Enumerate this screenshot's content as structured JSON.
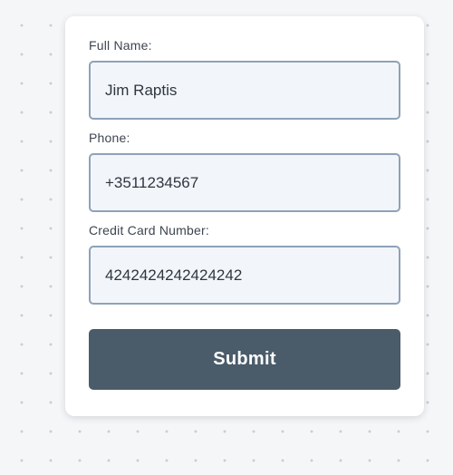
{
  "form": {
    "fields": [
      {
        "label": "Full Name:",
        "value": "Jim Raptis"
      },
      {
        "label": "Phone:",
        "value": "+3511234567"
      },
      {
        "label": "Credit Card Number:",
        "value": "4242424242424242"
      }
    ],
    "submit_label": "Submit"
  },
  "colors": {
    "background": "#f5f6f8",
    "dot": "#c9ced6",
    "card": "#ffffff",
    "input_border": "#8fa2b7",
    "input_background": "#f2f6fa",
    "button": "#4a5b69",
    "button_text": "#ffffff",
    "label_text": "#3d4550"
  }
}
